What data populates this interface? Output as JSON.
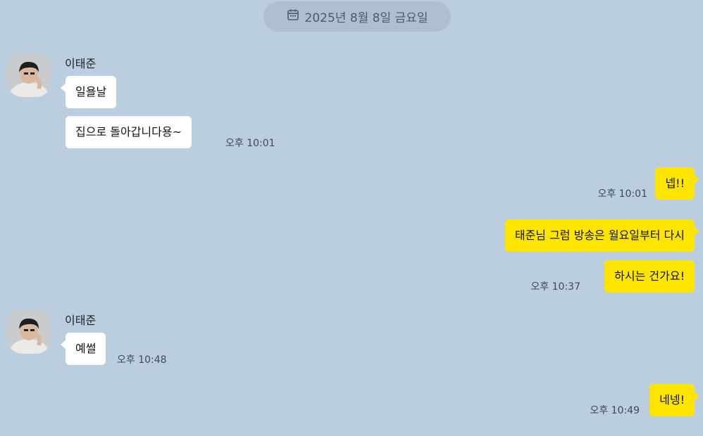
{
  "date_divider": {
    "icon": "calendar-icon",
    "label": "2025년 8월 8일 금요일"
  },
  "messages": [
    {
      "sender": "이태준",
      "bubbles": [
        "일욜날",
        "집으로 돌아갑니다용~"
      ],
      "time": "오후 10:01",
      "side": "in"
    },
    {
      "bubbles": [
        "넵!!"
      ],
      "time": "오후 10:01",
      "side": "out"
    },
    {
      "bubbles": [
        "태준님 그럼 방송은 월요일부터 다시",
        "하시는 건가요!"
      ],
      "time": "오후 10:37",
      "side": "out"
    },
    {
      "sender": "이태준",
      "bubbles": [
        "예썰"
      ],
      "time": "오후 10:48",
      "side": "in"
    },
    {
      "bubbles": [
        "네넹!"
      ],
      "time": "오후 10:49",
      "side": "out"
    }
  ],
  "colors": {
    "background": "#bacee0",
    "incoming_bubble": "#ffffff",
    "outgoing_bubble": "#fee500"
  }
}
